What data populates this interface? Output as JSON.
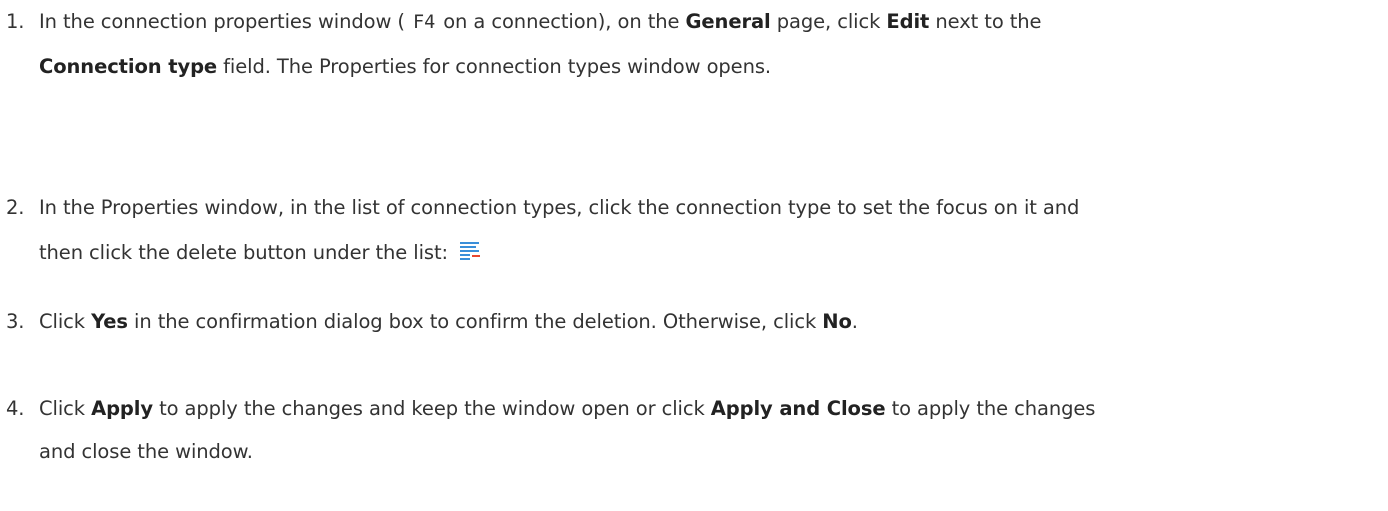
{
  "steps": [
    {
      "number": "1.",
      "p1": "In the connection properties window ( ",
      "key": "F4",
      "p2": " on a connection), on the ",
      "b1": "General",
      "p3": " page, click ",
      "b2": "Edit",
      "p4": " next to the",
      "b3": "Connection type",
      "p5": " field. The Properties for connection types window opens."
    },
    {
      "number": "2.",
      "line1": "In the Properties window, in the list of connection types, click the connection type to set the focus on it and",
      "line2": "then click the delete button under the list: ",
      "icon": "delete-list-item-icon"
    },
    {
      "number": "3.",
      "p1": "Click ",
      "b1": "Yes",
      "p2": " in the confirmation dialog box to confirm the deletion. Otherwise, click ",
      "b2": "No",
      "p3": "."
    },
    {
      "number": "4.",
      "p1": "Click ",
      "b1": "Apply",
      "p2": " to apply the changes and keep the window open or click ",
      "b2": "Apply and Close",
      "p3": " to apply the changes",
      "line2": "and close the window."
    }
  ],
  "colors": {
    "text": "#333333",
    "icon_lines": "#3a8fd9",
    "icon_minus": "#e8472f"
  }
}
